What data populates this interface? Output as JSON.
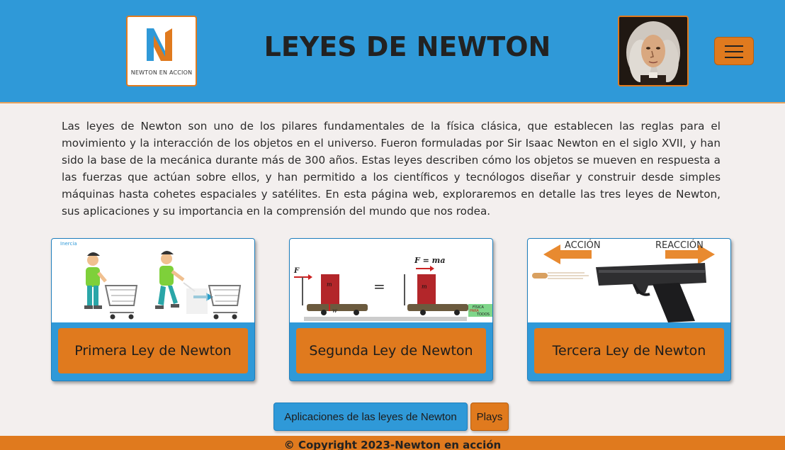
{
  "header": {
    "logo_text": "NEWTON EN ACCION",
    "title": "LEYES DE NEWTON"
  },
  "colors": {
    "primary_blue": "#2f99d8",
    "accent_orange": "#e07a1e",
    "page_background": "#f3efee"
  },
  "intro": {
    "text": "Las leyes de Newton son uno de los pilares fundamentales de la física clásica, que establecen las reglas para el movimiento y la interacción de los objetos en el universo. Fueron formuladas por Sir Isaac Newton en el siglo XVII, y han sido la base de la mecánica durante más de 300 años. Estas leyes describen cómo los objetos se mueven en respuesta a las fuerzas que actúan sobre ellos, y han permitido a los científicos y tecnólogos diseñar y construir desde simples máquinas hasta cohetes espaciales y satélites. En esta página web, exploraremos en detalle las tres leyes de Newton, sus aplicaciones y su importancia en la comprensión del mundo que nos rodea."
  },
  "cards": [
    {
      "label": "Primera Ley de Newton",
      "image_caption": "Inercia"
    },
    {
      "label": "Segunda Ley de Newton",
      "formula": "F = ma",
      "f_label": "F",
      "m_label": "m",
      "w_label": "w",
      "eq_sign": "=",
      "badge_line1": "FÍSICA",
      "badge_line2": "PARA",
      "badge_line3": "TODOS"
    },
    {
      "label": "Tercera Ley de Newton",
      "left_arrow": "ACCIÓN",
      "right_arrow": "REACCIÓN"
    }
  ],
  "buttons": {
    "applications": "Aplicaciones de las leyes de Newton",
    "plays": "Plays"
  },
  "footer": {
    "copyright": "© Copyright 2023-Newton en acción"
  }
}
